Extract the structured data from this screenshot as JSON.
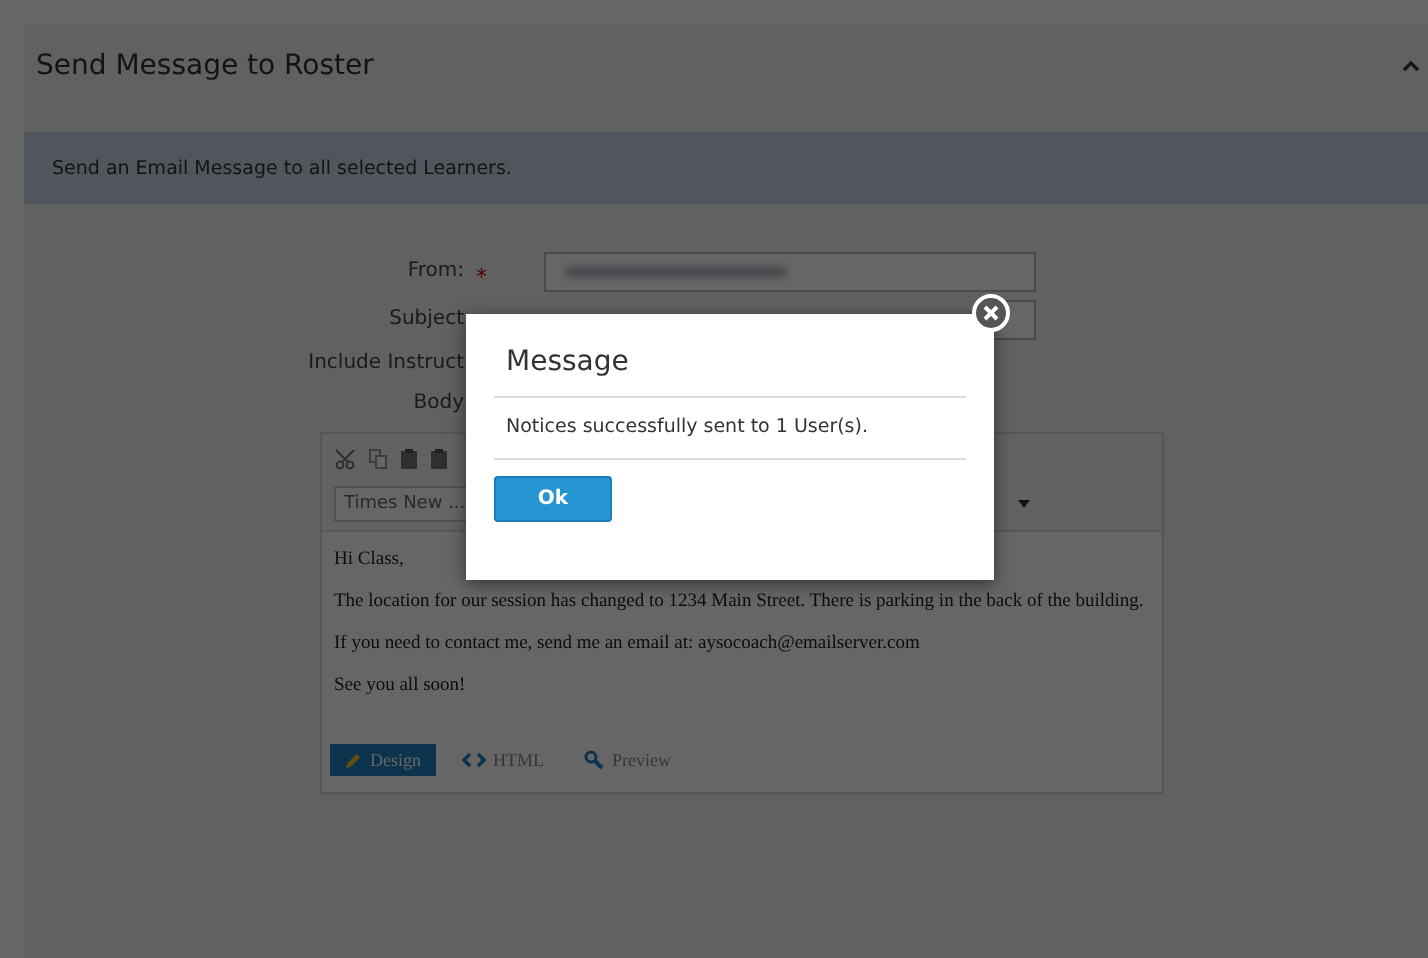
{
  "panel": {
    "title": "Send Message to Roster",
    "expanded": true
  },
  "info": "Send an Email Message to all selected Learners.",
  "fields": [
    {
      "label": "From:",
      "required_mark": "*",
      "kind": "blurred"
    },
    {
      "label": "Subject",
      "kind": "text"
    },
    {
      "label": "Include Instruct",
      "kind": "none"
    },
    {
      "label": "Body",
      "kind": "none"
    }
  ],
  "editor": {
    "font": "Times New ...",
    "paragraphs": [
      "Hi Class,",
      "The location for our session has changed to 1234 Main Street. There is parking in the back of the building.",
      "If you need to contact me, send me an email at: aysocoach@emailserver.com",
      "See you all soon!"
    ],
    "modes": [
      {
        "label": "Design",
        "kind": "design",
        "selected": true
      },
      {
        "label": "HTML",
        "kind": "html",
        "selected": false
      },
      {
        "label": "Preview",
        "kind": "preview",
        "selected": false
      }
    ]
  },
  "dialog": {
    "title": "Message",
    "text": "Notices successfully sent to 1 User(s).",
    "button": "Ok"
  }
}
